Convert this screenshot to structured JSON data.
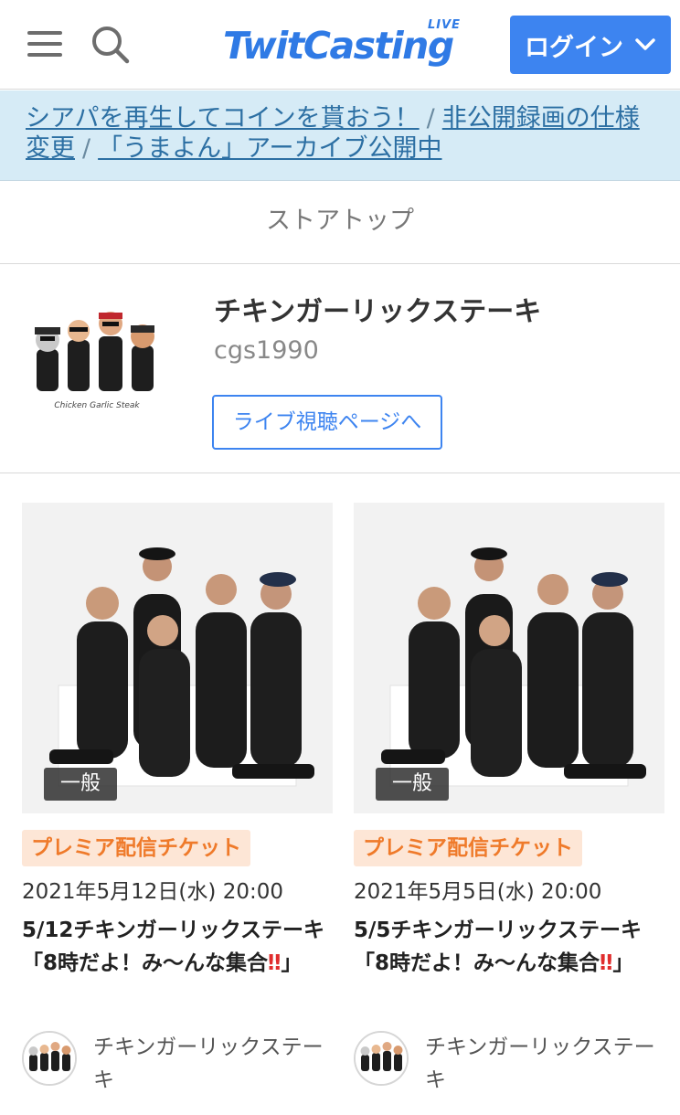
{
  "header": {
    "logo_text": "TwitCasting",
    "logo_badge": "LIVE",
    "login_label": "ログイン",
    "brand_color": "#3d84f0"
  },
  "notice": {
    "links": [
      "シアパを再生してコインを貰おう！",
      "非公開録画の仕様変更",
      "「うまよん」アーカイブ公開中"
    ],
    "separator": "/"
  },
  "store_top_label": "ストアトップ",
  "profile": {
    "name": "チキンガーリックステーキ",
    "user_id": "cgs1990",
    "live_button_label": "ライブ視聴ページへ",
    "avatar_caption": "Chicken Garlic Steak"
  },
  "cards": [
    {
      "badge": "一般",
      "ticket_label": "プレミア配信チケット",
      "date": "2021年5月12日(水) 20:00",
      "title": "5/12チキンガーリックステーキ「8時だよ！み〜んな集合",
      "title_suffix": "」",
      "bang": "‼",
      "author": "チキンガーリックステーキ"
    },
    {
      "badge": "一般",
      "ticket_label": "プレミア配信チケット",
      "date": "2021年5月5日(水) 20:00",
      "title": "5/5チキンガーリックステーキ「8時だよ！み〜んな集合",
      "title_suffix": "」",
      "bang": "‼",
      "author": "チキンガーリックステーキ"
    }
  ]
}
